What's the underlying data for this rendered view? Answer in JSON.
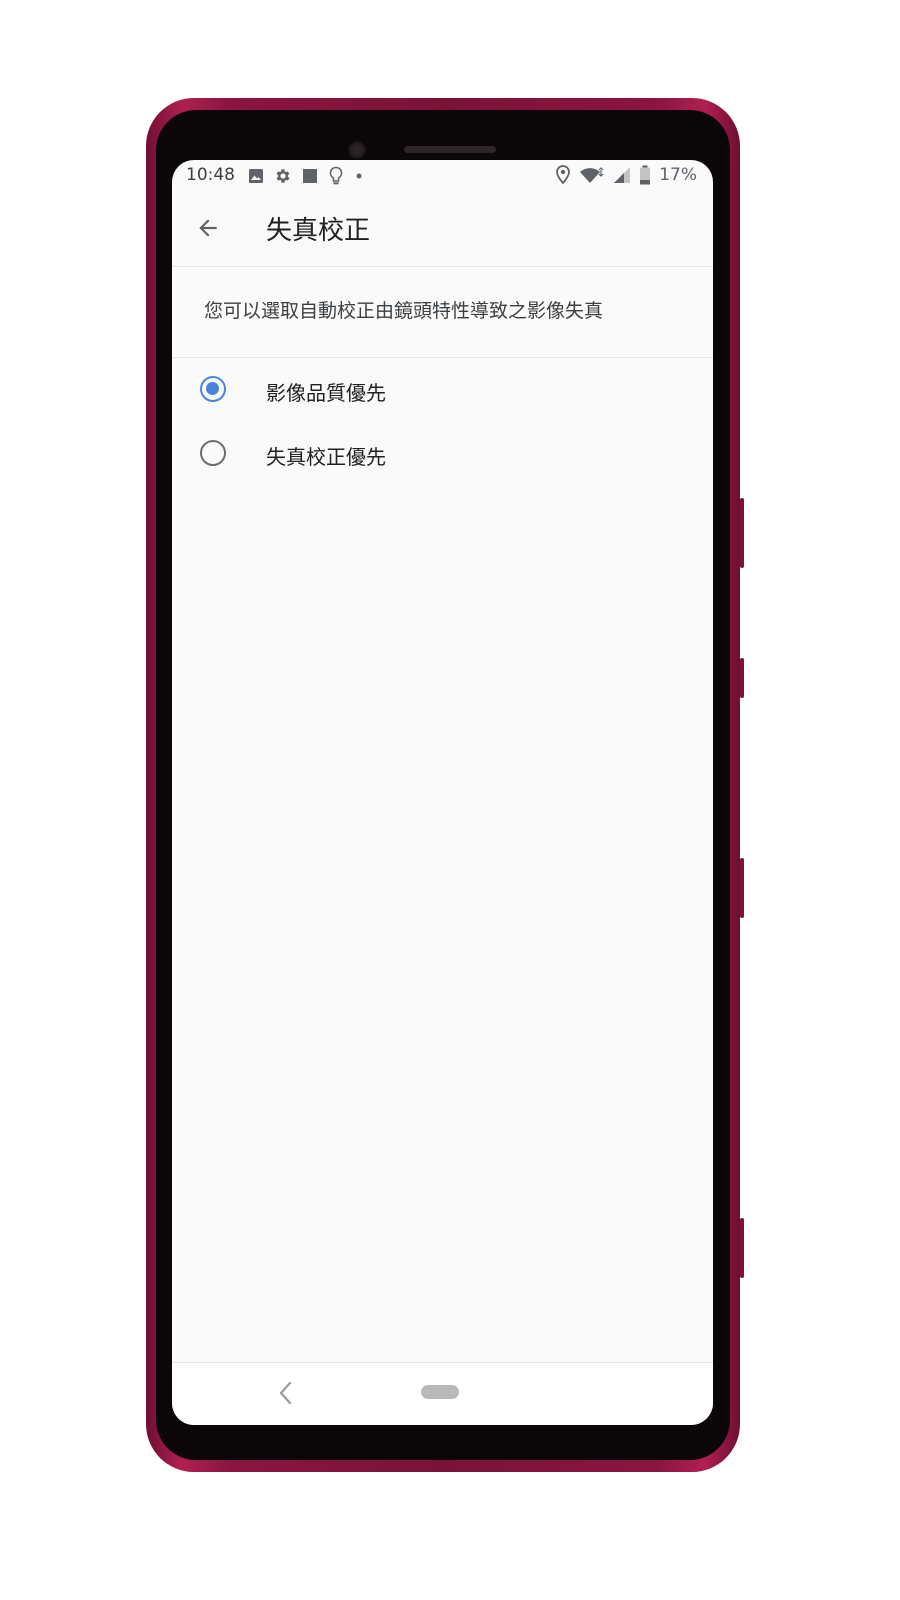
{
  "status_bar": {
    "time": "10:48",
    "battery_percent": "17%",
    "left_icons": [
      "image-icon",
      "gear-icon",
      "square-icon",
      "lightbulb-icon",
      "dot-icon"
    ],
    "right_icons": [
      "location-icon",
      "wifi-icon",
      "signal-icon",
      "battery-icon"
    ]
  },
  "app_bar": {
    "title": "失真校正"
  },
  "description": "您可以選取自動校正由鏡頭特性導致之影像失真",
  "options": [
    {
      "label": "影像品質優先",
      "selected": true
    },
    {
      "label": "失真校正優先",
      "selected": false
    }
  ],
  "colors": {
    "accent": "#4a86d8",
    "phone_body": "#8a1540",
    "screen_bg": "#fafafa"
  }
}
